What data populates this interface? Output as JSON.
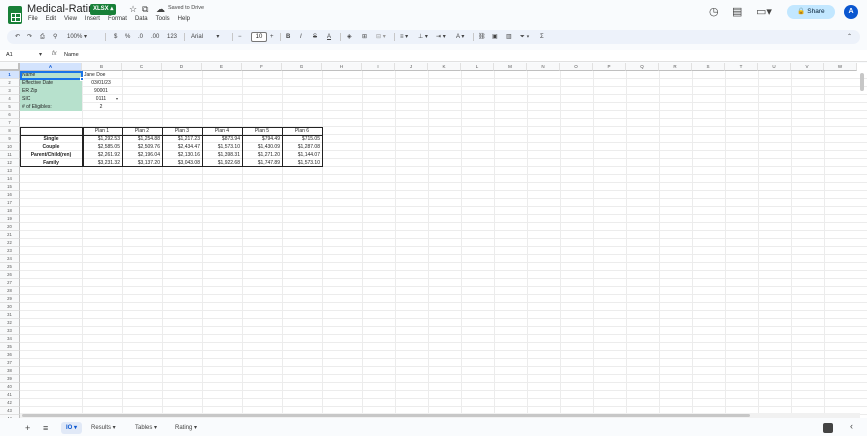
{
  "app": {
    "title": "Medical-Rating",
    "file_badge": "XLSX",
    "saved_status": "Saved to Drive",
    "menus": [
      "File",
      "Edit",
      "View",
      "Insert",
      "Format",
      "Data",
      "Tools",
      "Help"
    ],
    "share_label": "Share",
    "avatar_initial": "A"
  },
  "toolbar": {
    "zoom": "100%",
    "currency": "$",
    "percent": "%",
    "dec_decrease": ".0",
    "dec_increase": ".00",
    "number_format": "123",
    "font": "Arial",
    "font_size": "10"
  },
  "formula_bar": {
    "cell_ref": "A1",
    "fx": "fx",
    "value": "Name"
  },
  "grid": {
    "columns": [
      "A",
      "B",
      "C",
      "D",
      "E",
      "F",
      "G",
      "H",
      "I",
      "J",
      "K",
      "L",
      "M",
      "N",
      "O",
      "P",
      "Q",
      "R",
      "S",
      "T",
      "U",
      "V",
      "W"
    ],
    "row_count": 44,
    "selected_cell": "A1",
    "info_labels": [
      "Name",
      "Effective Date",
      "ER Zip",
      "SIC",
      "# of Eligibles:"
    ],
    "info_values": [
      "Jane Doe",
      "03/01/23",
      "90001",
      "0111",
      "2"
    ],
    "plans": [
      "Plan 1",
      "Plan 2",
      "Plan 3",
      "Plan 4",
      "Plan 5",
      "Plan 6"
    ],
    "tiers": [
      {
        "label": "Single",
        "rates": [
          "$1,292.53",
          "$1,254.88",
          "$1,217.23",
          "$873.94",
          "$794.49",
          "$715.05"
        ]
      },
      {
        "label": "Couple",
        "rates": [
          "$2,585.05",
          "$2,509.76",
          "$2,434.47",
          "$1,573.10",
          "$1,430.09",
          "$1,287.08"
        ]
      },
      {
        "label": "Parent/Child(ren)",
        "rates": [
          "$2,261.92",
          "$2,196.04",
          "$2,130.16",
          "$1,398.31",
          "$1,271.20",
          "$1,144.07"
        ]
      },
      {
        "label": "Family",
        "rates": [
          "$3,231.32",
          "$3,137.20",
          "$3,043.08",
          "$1,922.68",
          "$1,747.89",
          "$1,573.10"
        ]
      }
    ]
  },
  "sheet_tabs": [
    {
      "label": "IO",
      "active": true
    },
    {
      "label": "Results",
      "active": false
    },
    {
      "label": "Tables",
      "active": false
    },
    {
      "label": "Rating",
      "active": false
    }
  ],
  "icons": {
    "history": "history-icon",
    "comments": "comment-icon",
    "meet": "video-camera-icon",
    "share_lock": "lock-icon"
  }
}
